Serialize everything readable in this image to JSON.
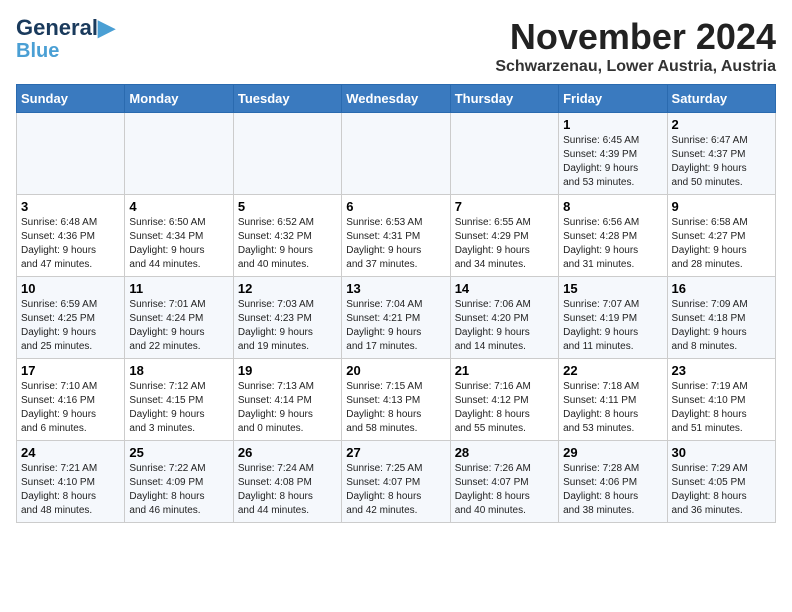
{
  "header": {
    "logo_line1": "General",
    "logo_line2": "Blue",
    "month": "November 2024",
    "location": "Schwarzenau, Lower Austria, Austria"
  },
  "days_of_week": [
    "Sunday",
    "Monday",
    "Tuesday",
    "Wednesday",
    "Thursday",
    "Friday",
    "Saturday"
  ],
  "weeks": [
    [
      {
        "day": "",
        "info": ""
      },
      {
        "day": "",
        "info": ""
      },
      {
        "day": "",
        "info": ""
      },
      {
        "day": "",
        "info": ""
      },
      {
        "day": "",
        "info": ""
      },
      {
        "day": "1",
        "info": "Sunrise: 6:45 AM\nSunset: 4:39 PM\nDaylight: 9 hours\nand 53 minutes."
      },
      {
        "day": "2",
        "info": "Sunrise: 6:47 AM\nSunset: 4:37 PM\nDaylight: 9 hours\nand 50 minutes."
      }
    ],
    [
      {
        "day": "3",
        "info": "Sunrise: 6:48 AM\nSunset: 4:36 PM\nDaylight: 9 hours\nand 47 minutes."
      },
      {
        "day": "4",
        "info": "Sunrise: 6:50 AM\nSunset: 4:34 PM\nDaylight: 9 hours\nand 44 minutes."
      },
      {
        "day": "5",
        "info": "Sunrise: 6:52 AM\nSunset: 4:32 PM\nDaylight: 9 hours\nand 40 minutes."
      },
      {
        "day": "6",
        "info": "Sunrise: 6:53 AM\nSunset: 4:31 PM\nDaylight: 9 hours\nand 37 minutes."
      },
      {
        "day": "7",
        "info": "Sunrise: 6:55 AM\nSunset: 4:29 PM\nDaylight: 9 hours\nand 34 minutes."
      },
      {
        "day": "8",
        "info": "Sunrise: 6:56 AM\nSunset: 4:28 PM\nDaylight: 9 hours\nand 31 minutes."
      },
      {
        "day": "9",
        "info": "Sunrise: 6:58 AM\nSunset: 4:27 PM\nDaylight: 9 hours\nand 28 minutes."
      }
    ],
    [
      {
        "day": "10",
        "info": "Sunrise: 6:59 AM\nSunset: 4:25 PM\nDaylight: 9 hours\nand 25 minutes."
      },
      {
        "day": "11",
        "info": "Sunrise: 7:01 AM\nSunset: 4:24 PM\nDaylight: 9 hours\nand 22 minutes."
      },
      {
        "day": "12",
        "info": "Sunrise: 7:03 AM\nSunset: 4:23 PM\nDaylight: 9 hours\nand 19 minutes."
      },
      {
        "day": "13",
        "info": "Sunrise: 7:04 AM\nSunset: 4:21 PM\nDaylight: 9 hours\nand 17 minutes."
      },
      {
        "day": "14",
        "info": "Sunrise: 7:06 AM\nSunset: 4:20 PM\nDaylight: 9 hours\nand 14 minutes."
      },
      {
        "day": "15",
        "info": "Sunrise: 7:07 AM\nSunset: 4:19 PM\nDaylight: 9 hours\nand 11 minutes."
      },
      {
        "day": "16",
        "info": "Sunrise: 7:09 AM\nSunset: 4:18 PM\nDaylight: 9 hours\nand 8 minutes."
      }
    ],
    [
      {
        "day": "17",
        "info": "Sunrise: 7:10 AM\nSunset: 4:16 PM\nDaylight: 9 hours\nand 6 minutes."
      },
      {
        "day": "18",
        "info": "Sunrise: 7:12 AM\nSunset: 4:15 PM\nDaylight: 9 hours\nand 3 minutes."
      },
      {
        "day": "19",
        "info": "Sunrise: 7:13 AM\nSunset: 4:14 PM\nDaylight: 9 hours\nand 0 minutes."
      },
      {
        "day": "20",
        "info": "Sunrise: 7:15 AM\nSunset: 4:13 PM\nDaylight: 8 hours\nand 58 minutes."
      },
      {
        "day": "21",
        "info": "Sunrise: 7:16 AM\nSunset: 4:12 PM\nDaylight: 8 hours\nand 55 minutes."
      },
      {
        "day": "22",
        "info": "Sunrise: 7:18 AM\nSunset: 4:11 PM\nDaylight: 8 hours\nand 53 minutes."
      },
      {
        "day": "23",
        "info": "Sunrise: 7:19 AM\nSunset: 4:10 PM\nDaylight: 8 hours\nand 51 minutes."
      }
    ],
    [
      {
        "day": "24",
        "info": "Sunrise: 7:21 AM\nSunset: 4:10 PM\nDaylight: 8 hours\nand 48 minutes."
      },
      {
        "day": "25",
        "info": "Sunrise: 7:22 AM\nSunset: 4:09 PM\nDaylight: 8 hours\nand 46 minutes."
      },
      {
        "day": "26",
        "info": "Sunrise: 7:24 AM\nSunset: 4:08 PM\nDaylight: 8 hours\nand 44 minutes."
      },
      {
        "day": "27",
        "info": "Sunrise: 7:25 AM\nSunset: 4:07 PM\nDaylight: 8 hours\nand 42 minutes."
      },
      {
        "day": "28",
        "info": "Sunrise: 7:26 AM\nSunset: 4:07 PM\nDaylight: 8 hours\nand 40 minutes."
      },
      {
        "day": "29",
        "info": "Sunrise: 7:28 AM\nSunset: 4:06 PM\nDaylight: 8 hours\nand 38 minutes."
      },
      {
        "day": "30",
        "info": "Sunrise: 7:29 AM\nSunset: 4:05 PM\nDaylight: 8 hours\nand 36 minutes."
      }
    ]
  ]
}
